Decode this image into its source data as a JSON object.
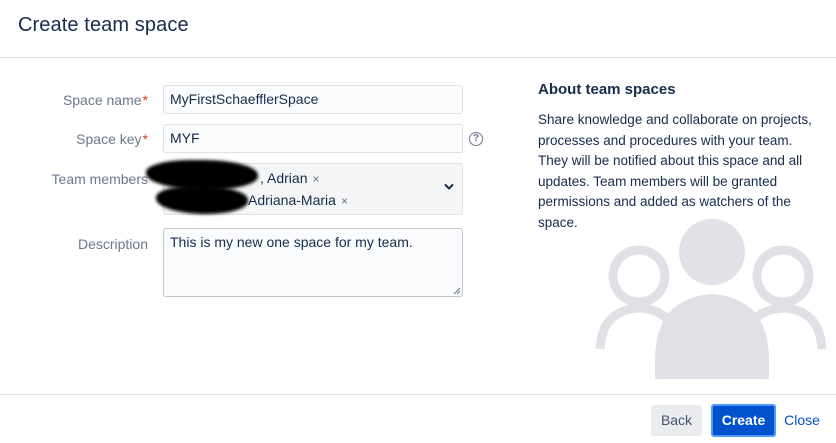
{
  "dialog": {
    "title": "Create team space"
  },
  "form": {
    "space_name": {
      "label": "Space name",
      "required_marker": "*",
      "value": "MyFirstSchaefflerSpace"
    },
    "space_key": {
      "label": "Space key",
      "required_marker": "*",
      "value": "MYF",
      "help_icon": "?"
    },
    "team_members": {
      "label": "Team members",
      "members": [
        {
          "name": ", Adrian",
          "remove": "×"
        },
        {
          "name": "Adriana-Maria",
          "remove": "×"
        }
      ],
      "icon": "chevron-down-icon"
    },
    "description": {
      "label": "Description",
      "value": "This is my new one space for my team."
    }
  },
  "about": {
    "title": "About team spaces",
    "text": "Share knowledge and collaborate on projects, processes and procedures with your team. They will be notified about this space and all updates. Team members will be granted permissions and added as watchers of the space."
  },
  "footer": {
    "back_label": "Back",
    "create_label": "Create",
    "close_label": "Close"
  },
  "colors": {
    "primary": "#0052cc",
    "link": "#0052cc",
    "required": "#de350b",
    "illustration": "#dfe1e6"
  }
}
